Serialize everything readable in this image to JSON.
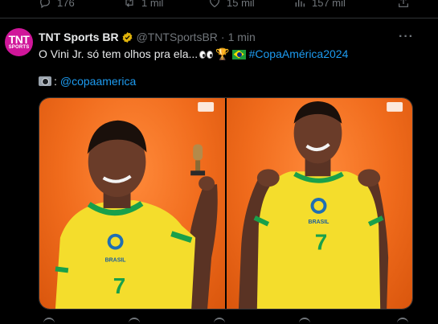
{
  "prev_tweet_actions": {
    "replies": "176",
    "retweets": "1 mil",
    "likes": "15 mil",
    "views": "157 mil"
  },
  "tweet": {
    "avatar_line1": "TNT",
    "avatar_line2": "SPORTS",
    "display_name": "TNT Sports BR",
    "handle": "@TNTSportsBR",
    "separator": "·",
    "time": "1 min",
    "more_label": "···",
    "text": "O Vini Jr. só tem olhos pra ela...",
    "hashtag": "#CopaAmérica2024",
    "credit_colon": ":",
    "credit_mention": "@copaamerica",
    "photo_left_number": "7",
    "photo_left_badge": "BRASIL",
    "photo_right_number": "7",
    "photo_right_badge": "BRASIL"
  },
  "colors": {
    "background": "#000000",
    "text": "#e7e9ea",
    "muted": "#71767b",
    "link": "#1d9bf0",
    "brand": "#d0169a",
    "photo_bg": "#f06b1c",
    "jersey": "#f7e23a"
  },
  "icons": {
    "reply": "reply-icon",
    "retweet": "retweet-icon",
    "like": "heart-icon",
    "views": "views-icon",
    "share": "share-icon",
    "verified": "verified-badge-icon",
    "more": "more-options-icon"
  }
}
